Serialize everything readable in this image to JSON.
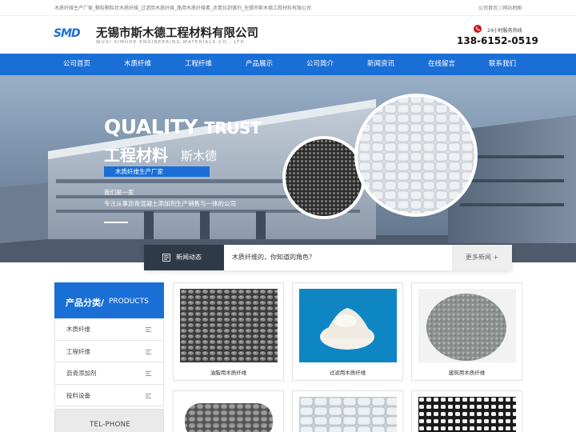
{
  "topbar": {
    "left_text": "木质纤维生产厂家_颗粒颗粒状木质纤维_过滤用木质纤维_路用木质纤维素_沥青抗剥落剂_无锡市斯木德工程材料有限公司",
    "right_home": "公司首页",
    "right_sep": "|",
    "right_sitemap": "网站地图"
  },
  "header": {
    "logo_text": "SMD",
    "company_cn": "无锡市斯木德工程材料有限公司",
    "company_en": "WUXI SIMUDE ENGINEERING MATERIALS CO., LTD",
    "hotline_label": "24小时服务热线",
    "hotline_number": "138-6152-0519"
  },
  "nav": {
    "items": [
      "公司首页",
      "木质纤维",
      "工程纤维",
      "产品展示",
      "公司简介",
      "新闻资讯",
      "在线留言",
      "联系我们"
    ]
  },
  "banner": {
    "quality": "QUALITY",
    "trust": "TRUST",
    "cn_title": "工程材料",
    "cn_sub": "斯木德",
    "tag": "木质纤维生产厂家",
    "intro1": "我们是一家",
    "intro2": "专注从事沥青混凝土添加剂生产销售与一体的公司"
  },
  "news": {
    "label": "新闻动态",
    "text": "木质纤维的，你知道的角色？",
    "more": "更多新闻 +"
  },
  "sidebar": {
    "title_cn": "产品分类/",
    "title_en": "PRODUCTS",
    "items": [
      "木质纤维",
      "工程纤维",
      "沥青添加剂",
      "投料设备"
    ],
    "tel": "TEL-PHONE"
  },
  "products": [
    {
      "caption": "油脂用木质纤维"
    },
    {
      "caption": "过滤用木质纤维"
    },
    {
      "caption": "建筑用木质纤维"
    }
  ],
  "colors": {
    "brand_blue": "#1a6fd6",
    "news_label_bg": "#2e3a48"
  }
}
